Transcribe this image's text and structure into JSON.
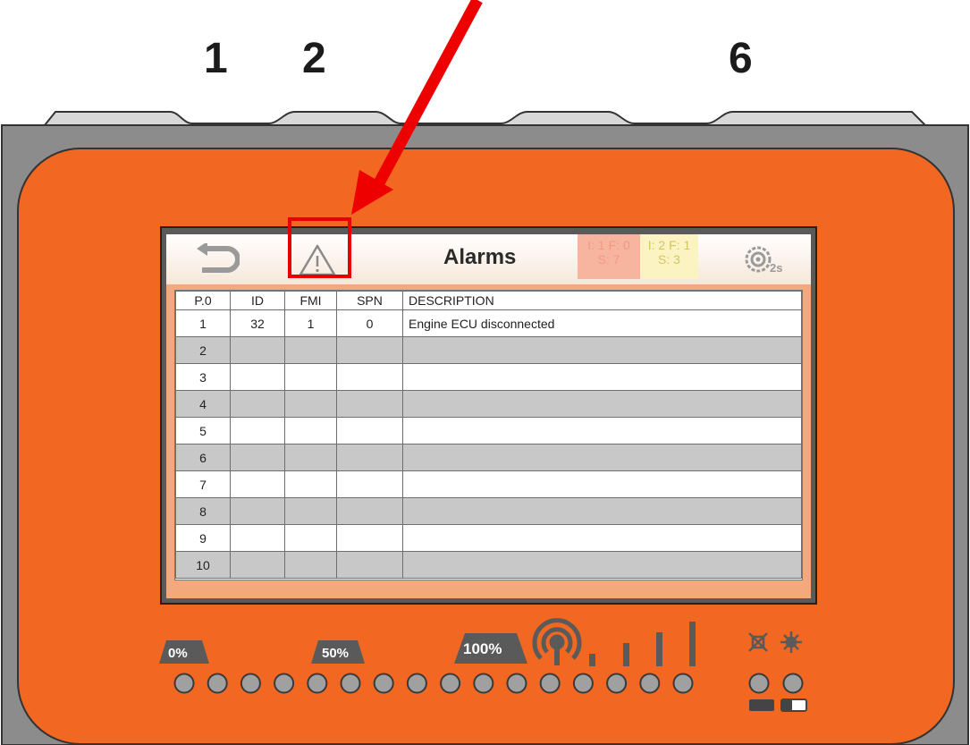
{
  "keys": [
    "1",
    "2",
    "6"
  ],
  "screen": {
    "title": "Alarms",
    "counters": {
      "group1": {
        "line1": "I: 1  F: 0",
        "line2": "S: 7"
      },
      "group2": {
        "line1": "I: 2  F: 1",
        "line2": "S: 3"
      }
    },
    "interval_label": "2s"
  },
  "table": {
    "headers": [
      "P.0",
      "ID",
      "FMI",
      "SPN",
      "DESCRIPTION"
    ],
    "rows": [
      [
        "1",
        "32",
        "1",
        "0",
        "Engine ECU disconnected"
      ],
      [
        "2",
        "",
        "",
        "",
        ""
      ],
      [
        "3",
        "",
        "",
        "",
        ""
      ],
      [
        "4",
        "",
        "",
        "",
        ""
      ],
      [
        "5",
        "",
        "",
        "",
        ""
      ],
      [
        "6",
        "",
        "",
        "",
        ""
      ],
      [
        "7",
        "",
        "",
        "",
        ""
      ],
      [
        "8",
        "",
        "",
        "",
        ""
      ],
      [
        "9",
        "",
        "",
        "",
        ""
      ],
      [
        "10",
        "",
        "",
        "",
        ""
      ]
    ]
  },
  "leds": {
    "labels": {
      "zero": "0%",
      "half": "50%",
      "full": "100%"
    },
    "bar_count": 16,
    "status_count": 2
  },
  "colors": {
    "panel_orange": "#f26822",
    "frame_gray": "#8f8f8f",
    "highlight_red": "#e60000",
    "arrow_red": "#ee0000"
  }
}
